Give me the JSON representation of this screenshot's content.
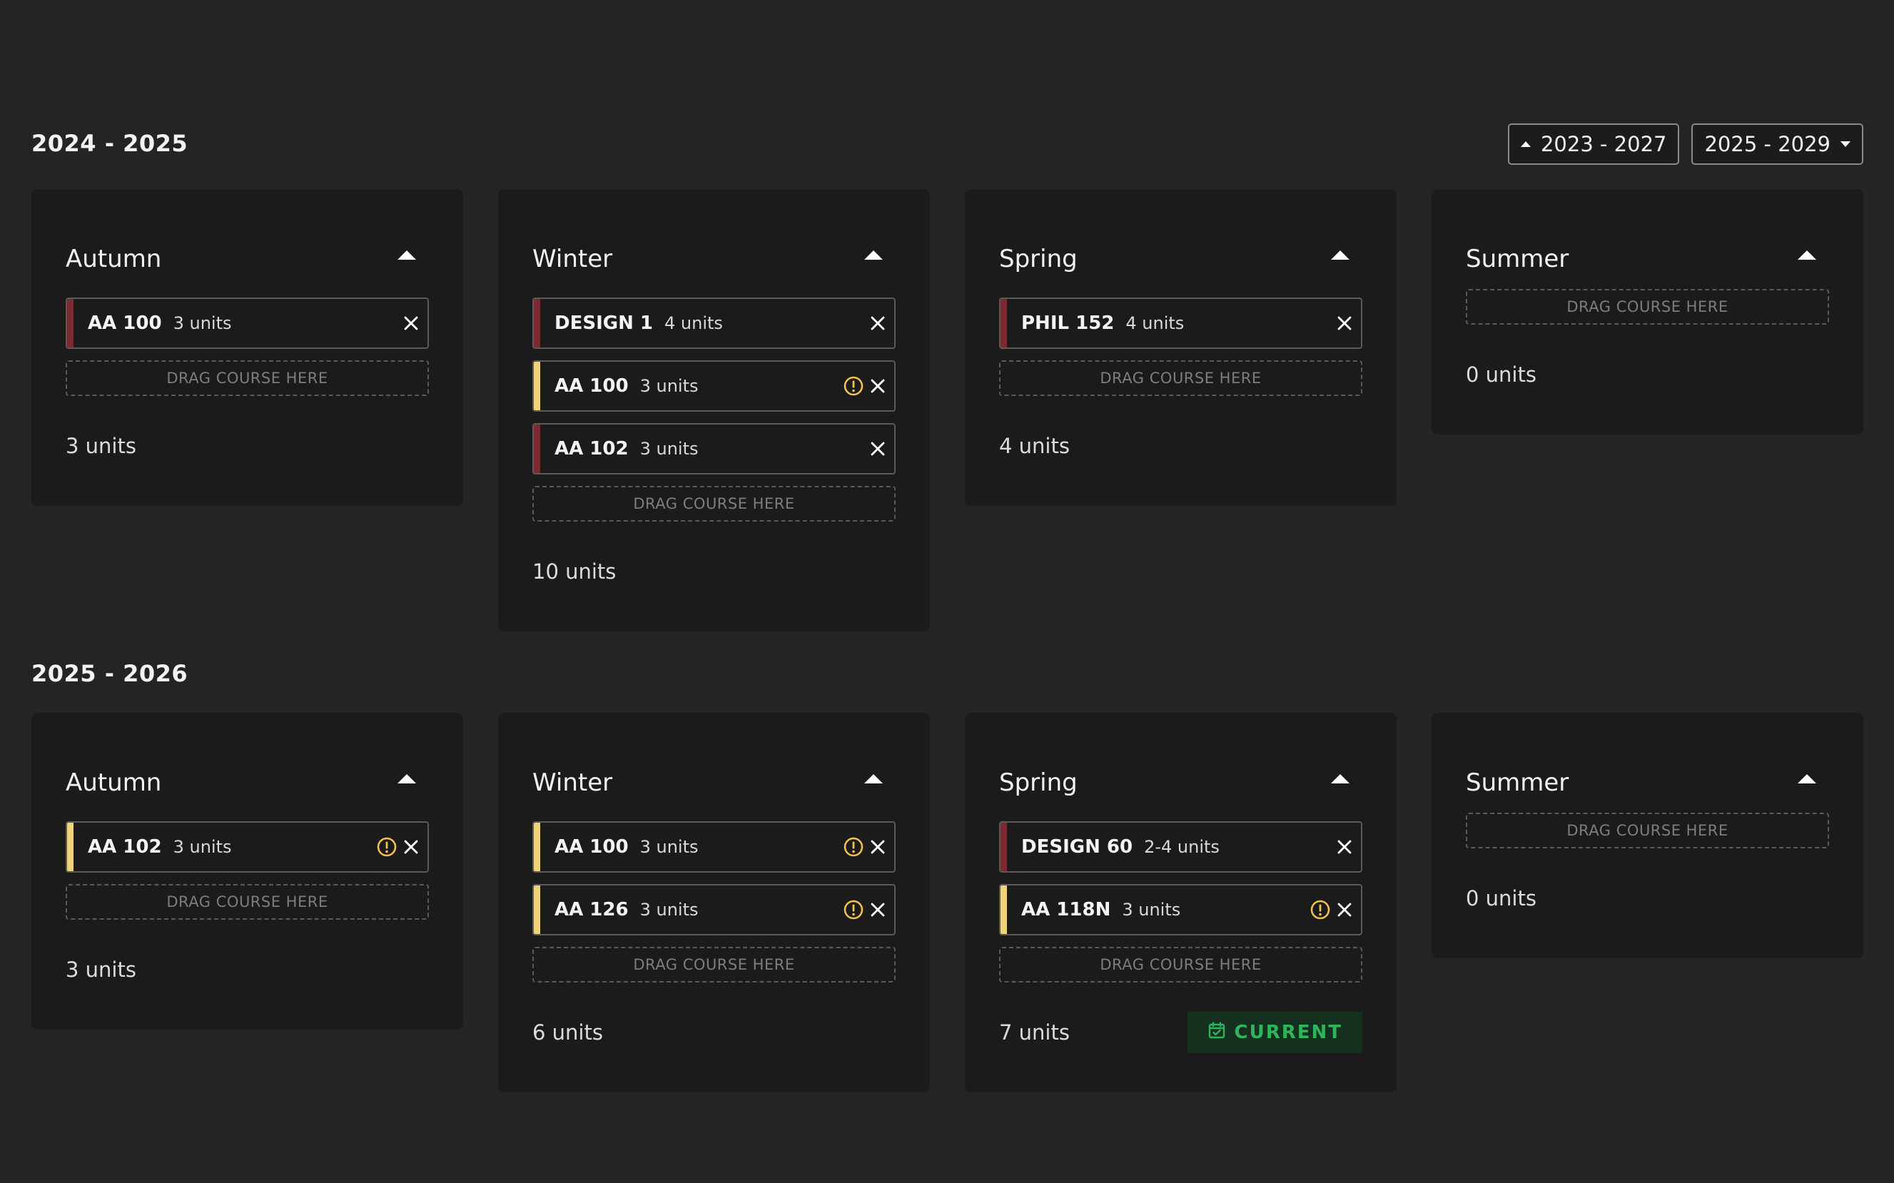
{
  "header": {
    "range_prev_label": "2023 - 2027",
    "range_next_label": "2025 - 2029"
  },
  "colors": {
    "background": "#242424",
    "card": "#1b1b1b",
    "bar_red": "#7a2b32",
    "bar_yellow": "#f0d27a",
    "warning": "#f2c14e",
    "current_green": "#2fb35b",
    "current_bg": "#15301f"
  },
  "drop_label": "DRAG COURSE HERE",
  "years": [
    {
      "title": "2024 - 2025",
      "quarters": [
        {
          "name": "Autumn",
          "courses": [
            {
              "code": "AA 100",
              "units": "3 units",
              "status": "ok"
            }
          ],
          "total": "3 units"
        },
        {
          "name": "Winter",
          "courses": [
            {
              "code": "DESIGN 1",
              "units": "4 units",
              "status": "ok"
            },
            {
              "code": "AA 100",
              "units": "3 units",
              "status": "warning"
            },
            {
              "code": "AA 102",
              "units": "3 units",
              "status": "ok"
            }
          ],
          "total": "10 units"
        },
        {
          "name": "Spring",
          "courses": [
            {
              "code": "PHIL 152",
              "units": "4 units",
              "status": "ok"
            }
          ],
          "total": "4 units"
        },
        {
          "name": "Summer",
          "courses": [],
          "total": "0 units"
        }
      ]
    },
    {
      "title": "2025 - 2026",
      "quarters": [
        {
          "name": "Autumn",
          "courses": [
            {
              "code": "AA 102",
              "units": "3 units",
              "status": "warning"
            }
          ],
          "total": "3 units"
        },
        {
          "name": "Winter",
          "courses": [
            {
              "code": "AA 100",
              "units": "3 units",
              "status": "warning"
            },
            {
              "code": "AA 126",
              "units": "3 units",
              "status": "warning"
            }
          ],
          "total": "6 units"
        },
        {
          "name": "Spring",
          "courses": [
            {
              "code": "DESIGN 60",
              "units": "2-4 units",
              "status": "ok"
            },
            {
              "code": "AA 118N",
              "units": "3 units",
              "status": "warning"
            }
          ],
          "total": "7 units",
          "badge": "CURRENT"
        },
        {
          "name": "Summer",
          "courses": [],
          "total": "0 units"
        }
      ]
    }
  ]
}
